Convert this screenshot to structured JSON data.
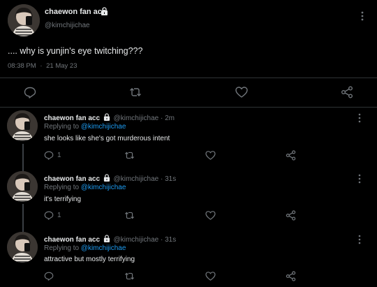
{
  "main_tweet": {
    "display_name": "chaewon fan acc",
    "handle": "@kimchijichae",
    "text": ".... why is yunjin's eye twitching???",
    "time": "08:38 PM",
    "separator": "·",
    "date": "21 May 23"
  },
  "replies": [
    {
      "display_name": "chaewon fan acc",
      "handle": "@kimchijichae",
      "age": "2m",
      "replying_prefix": "Replying to",
      "replying_handle": "@kimchijichae",
      "text": "she looks like she's got murderous intent",
      "reply_count": "1"
    },
    {
      "display_name": "chaewon fan acc",
      "handle": "@kimchijichae",
      "age": "31s",
      "replying_prefix": "Replying to",
      "replying_handle": "@kimchijichae",
      "text": "it's terrifying",
      "reply_count": "1"
    },
    {
      "display_name": "chaewon fan acc",
      "handle": "@kimchijichae",
      "age": "31s",
      "replying_prefix": "Replying to",
      "replying_handle": "@kimchijichae",
      "text": "attractive but mostly terrifying",
      "reply_count": ""
    }
  ],
  "icons": {
    "lock": "lock-icon",
    "more": "more-icon",
    "reply": "reply-icon",
    "retweet": "retweet-icon",
    "like": "like-icon",
    "share": "share-icon"
  },
  "colors": {
    "background": "#000000",
    "text": "#e7e9ea",
    "muted": "#71767b",
    "link": "#1d9bf0",
    "divider": "#2f3336"
  }
}
